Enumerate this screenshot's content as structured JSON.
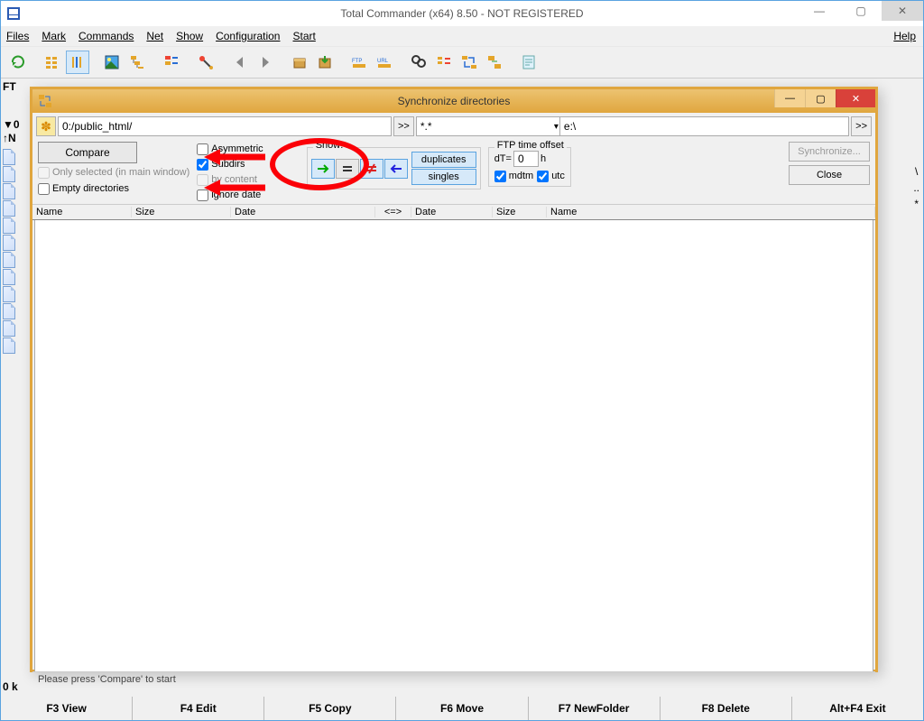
{
  "window": {
    "title": "Total Commander (x64) 8.50 - NOT REGISTERED",
    "menu": {
      "files": "Files",
      "mark": "Mark",
      "commands": "Commands",
      "net": "Net",
      "show": "Show",
      "config": "Configuration",
      "start": "Start",
      "help": "Help"
    },
    "status_left": "FT",
    "status_zero": "▼0",
    "n_row": "↑N",
    "status_0k": "0 k",
    "footer": {
      "f3": "F3 View",
      "f4": "F4 Edit",
      "f5": "F5 Copy",
      "f6": "F6 Move",
      "f7": "F7 NewFolder",
      "f8": "F8 Delete",
      "altf4": "Alt+F4 Exit"
    },
    "right_strip": {
      "backslash": "\\",
      "dotdot": "..",
      "star": "*"
    }
  },
  "dialog": {
    "title": "Synchronize directories",
    "left_path": "0:/public_html/",
    "filter": "*.*",
    "right_path": "e:\\",
    "browse": ">>",
    "compare_btn": "Compare",
    "chk": {
      "asymmetric": "Asymmetric",
      "subdirs": "Subdirs",
      "only_selected": "Only selected (in main window)",
      "by_content": "by content",
      "empty_dirs": "Empty directories",
      "ignore_date": "ignore date"
    },
    "show_label": "Show:",
    "dup_btn": "duplicates",
    "singles_btn": "singles",
    "ftp_label": "FTP time offset",
    "dt_label": "dT=",
    "dt_value": "0",
    "h_label": "h",
    "mdtm": "mdtm",
    "utc": "utc",
    "sync_btn": "Synchronize...",
    "close_btn": "Close",
    "columns": {
      "name_l": "Name",
      "size_l": "Size",
      "date_l": "Date",
      "dir": "<=>",
      "date_r": "Date",
      "size_r": "Size",
      "name_r": "Name"
    },
    "status": "Please press 'Compare' to start"
  }
}
